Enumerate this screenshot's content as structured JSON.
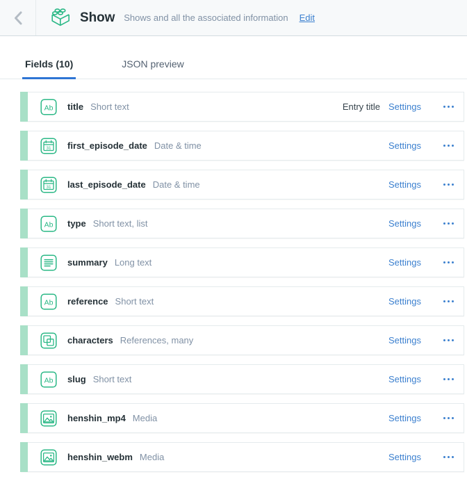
{
  "header": {
    "back_icon": "chevron-left-icon",
    "content_type_icon": "lego-brick-icon",
    "title": "Show",
    "description": "Shows and all the associated information",
    "edit_label": "Edit",
    "accent_green": "#2bb886",
    "link_blue": "#3c80cf"
  },
  "tabs": [
    {
      "label": "Fields (10)",
      "active": true
    },
    {
      "label": "JSON preview",
      "active": false
    }
  ],
  "fields": [
    {
      "name": "title",
      "type": "Short text",
      "icon": "short-text-icon",
      "tag": "Entry title",
      "settings_label": "Settings",
      "more_label": "…"
    },
    {
      "name": "first_episode_date",
      "type": "Date & time",
      "icon": "calendar-icon",
      "tag": "",
      "settings_label": "Settings",
      "more_label": "…"
    },
    {
      "name": "last_episode_date",
      "type": "Date & time",
      "icon": "calendar-icon",
      "tag": "",
      "settings_label": "Settings",
      "more_label": "…"
    },
    {
      "name": "type",
      "type": "Short text, list",
      "icon": "short-text-icon",
      "tag": "",
      "settings_label": "Settings",
      "more_label": "…"
    },
    {
      "name": "summary",
      "type": "Long text",
      "icon": "long-text-icon",
      "tag": "",
      "settings_label": "Settings",
      "more_label": "…"
    },
    {
      "name": "reference",
      "type": "Short text",
      "icon": "short-text-icon",
      "tag": "",
      "settings_label": "Settings",
      "more_label": "…"
    },
    {
      "name": "characters",
      "type": "References, many",
      "icon": "reference-icon",
      "tag": "",
      "settings_label": "Settings",
      "more_label": "…"
    },
    {
      "name": "slug",
      "type": "Short text",
      "icon": "short-text-icon",
      "tag": "",
      "settings_label": "Settings",
      "more_label": "…"
    },
    {
      "name": "henshin_mp4",
      "type": "Media",
      "icon": "media-image-icon",
      "tag": "",
      "settings_label": "Settings",
      "more_label": "…"
    },
    {
      "name": "henshin_webm",
      "type": "Media",
      "icon": "media-image-icon",
      "tag": "",
      "settings_label": "Settings",
      "more_label": "…"
    }
  ]
}
